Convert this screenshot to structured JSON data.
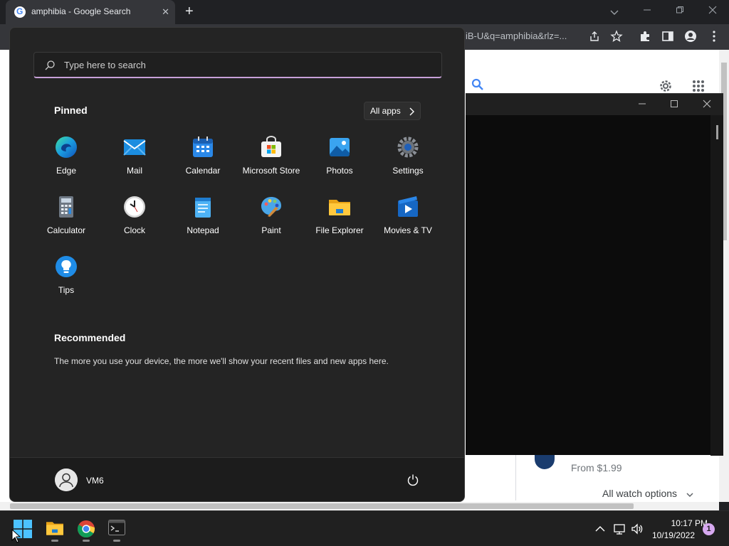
{
  "browser": {
    "tab_title": "amphibia - Google Search",
    "tab_close": "✕",
    "new_tab": "+",
    "url": "iB-U&q=amphibia&rlz=..."
  },
  "page": {
    "offer_price": "From $1.99",
    "watch_options": "All watch options"
  },
  "start_menu": {
    "search_placeholder": "Type here to search",
    "pinned_heading": "Pinned",
    "all_apps_label": "All apps",
    "pinned_apps": [
      {
        "label": "Edge",
        "icon": "edge-icon"
      },
      {
        "label": "Mail",
        "icon": "mail-icon"
      },
      {
        "label": "Calendar",
        "icon": "calendar-icon"
      },
      {
        "label": "Microsoft Store",
        "icon": "store-icon"
      },
      {
        "label": "Photos",
        "icon": "photos-icon"
      },
      {
        "label": "Settings",
        "icon": "settings-icon"
      },
      {
        "label": "Calculator",
        "icon": "calculator-icon"
      },
      {
        "label": "Clock",
        "icon": "clock-icon"
      },
      {
        "label": "Notepad",
        "icon": "notepad-icon"
      },
      {
        "label": "Paint",
        "icon": "paint-icon"
      },
      {
        "label": "File Explorer",
        "icon": "file-explorer-icon"
      },
      {
        "label": "Movies & TV",
        "icon": "movies-tv-icon"
      },
      {
        "label": "Tips",
        "icon": "tips-icon"
      }
    ],
    "recommended_heading": "Recommended",
    "recommended_text": "The more you use your device, the more we'll show your recent files and new apps here.",
    "user_name": "VM6"
  },
  "taskbar": {
    "time": "10:17 PM",
    "date": "10/19/2022",
    "notification_count": "1"
  },
  "colors": {
    "start_bg": "#242424",
    "taskbar_bg": "#202020",
    "search_accent": "#c7a0d8",
    "chrome_frame": "#202124"
  }
}
